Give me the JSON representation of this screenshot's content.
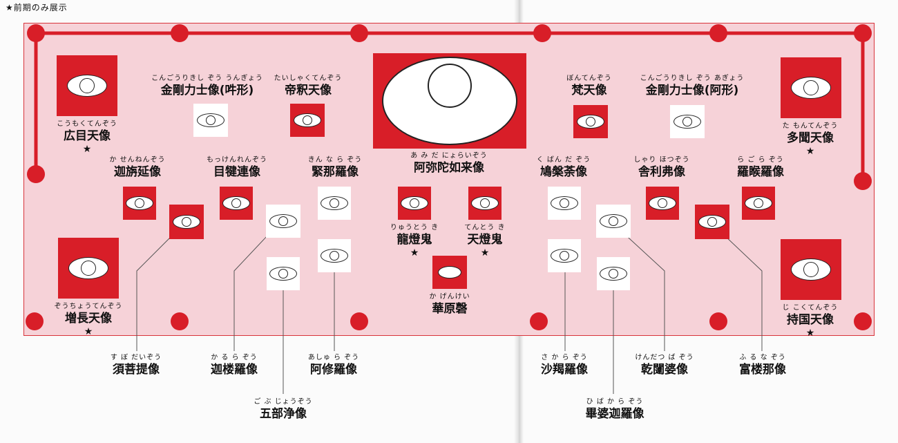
{
  "note": "★前期のみ展示",
  "star_symbol": "★",
  "colors": {
    "frame": "#d81e28",
    "stage": "#f6d2d8",
    "paper": "#fbfbfb",
    "line": "#555555"
  },
  "center": {
    "ruby": "あ み だ にょらいぞう",
    "name": "阿弥陀如来像"
  },
  "statues": [
    {
      "id": "koumokuten",
      "ruby": "こうもくてんぞう",
      "name": "広目天像",
      "star": true
    },
    {
      "id": "zouchouten",
      "ruby": "ぞうちょうてんぞう",
      "name": "増長天像",
      "star": true
    },
    {
      "id": "tamonten",
      "ruby": "た もんてんぞう",
      "name": "多聞天像",
      "star": true
    },
    {
      "id": "jikokuten",
      "ruby": "じ こくてんぞう",
      "name": "持国天像",
      "star": true
    },
    {
      "id": "kongo-un",
      "ruby": "こんごうりきし ぞう うんぎょう",
      "name": "金剛力士像(吽形)",
      "star": false
    },
    {
      "id": "taishakuten",
      "ruby": "たいしゃくてんぞう",
      "name": "帝釈天像",
      "star": false
    },
    {
      "id": "bonten",
      "ruby": "ぼんてんぞう",
      "name": "梵天像",
      "star": false
    },
    {
      "id": "kongo-a",
      "ruby": "こんごうりきし ぞう あぎょう",
      "name": "金剛力士像(阿形)",
      "star": false
    },
    {
      "id": "kasennen",
      "ruby": "か せんねんぞう",
      "name": "迦旃延像",
      "star": false
    },
    {
      "id": "mokkenren",
      "ruby": "もっけんれんぞう",
      "name": "目犍連像",
      "star": false
    },
    {
      "id": "kinnara",
      "ruby": "きん な ら ぞう",
      "name": "緊那羅像",
      "star": false
    },
    {
      "id": "kubanda",
      "ruby": "く ばん だ ぞう",
      "name": "鳩槃荼像",
      "star": false
    },
    {
      "id": "sharihotsu",
      "ruby": "しゃり ほつぞう",
      "name": "舎利弗像",
      "star": false
    },
    {
      "id": "ragora",
      "ruby": "ら ご ら ぞう",
      "name": "羅睺羅像",
      "star": false
    },
    {
      "id": "ryutouki",
      "ruby": "りゅうとう き",
      "name": "龍燈鬼",
      "star": true
    },
    {
      "id": "tentouki",
      "ruby": "てんとう き",
      "name": "天燈鬼",
      "star": true
    },
    {
      "id": "kagenkei",
      "ruby": "か げんけい",
      "name": "華原磬",
      "star": false
    },
    {
      "id": "subodai",
      "ruby": "す ぼ だいぞう",
      "name": "須菩提像",
      "star": false
    },
    {
      "id": "karura",
      "ruby": "か る ら ぞう",
      "name": "迦楼羅像",
      "star": false
    },
    {
      "id": "ashura",
      "ruby": "あしゅ ら ぞう",
      "name": "阿修羅像",
      "star": false
    },
    {
      "id": "gobujou",
      "ruby": "ご ぶ じょうぞう",
      "name": "五部浄像",
      "star": false
    },
    {
      "id": "sakara",
      "ruby": "さ か ら ぞう",
      "name": "沙羯羅像",
      "star": false
    },
    {
      "id": "kendatsuba",
      "ruby": "けんだつ ば ぞう",
      "name": "乾闥婆像",
      "star": false
    },
    {
      "id": "furuna",
      "ruby": "ふ る な ぞう",
      "name": "富楼那像",
      "star": false
    },
    {
      "id": "hibakara",
      "ruby": "ひ ば か ら ぞう",
      "name": "畢婆迦羅像",
      "star": false
    }
  ]
}
